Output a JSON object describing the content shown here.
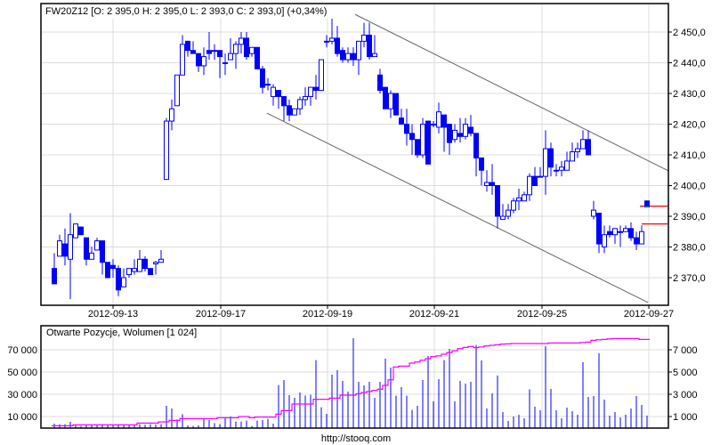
{
  "chart_data": [
    {
      "type": "candlestick",
      "title": "FW20Z12 [O: 2 395,0  H: 2 395,0  L: 2 393,0  C: 2 393,0] (+0,34%)",
      "x_tick_labels": [
        "2012-09-13",
        "2012-09-17",
        "2012-09-19",
        "2012-09-21",
        "2012-09-25",
        "2012-09-27"
      ],
      "y_tick_labels": [
        "2 450,0",
        "2 440,0",
        "2 430,0",
        "2 420,0",
        "2 410,0",
        "2 400,0",
        "2 390,0",
        "2 380,0",
        "2 370,0"
      ],
      "y_ticks": [
        2450,
        2440,
        2430,
        2420,
        2410,
        2400,
        2390,
        2380,
        2370
      ],
      "ylim": [
        2362,
        2465
      ],
      "grid": true,
      "colors": {
        "candle": "#0000ff",
        "channel": "#666666",
        "level": "#ff0000",
        "last_close_mark": "#00cc00"
      },
      "ohlc_columns": [
        "open",
        "high",
        "low",
        "close"
      ],
      "ohlc": [
        [
          2373,
          2378,
          2368,
          2368
        ],
        [
          2377,
          2384,
          2377,
          2382
        ],
        [
          2381,
          2386,
          2374,
          2377
        ],
        [
          2376,
          2391,
          2363,
          2384
        ],
        [
          2383,
          2387.5,
          2383,
          2387.5
        ],
        [
          2386.5,
          2386.5,
          2384,
          2384
        ],
        [
          2383,
          2383,
          2374,
          2376
        ],
        [
          2376,
          2380,
          2376,
          2378
        ],
        [
          2379,
          2383,
          2379,
          2382
        ],
        [
          2382,
          2382,
          2371,
          2375
        ],
        [
          2375,
          2375,
          2370,
          2370
        ],
        [
          2374,
          2376,
          2370,
          2373
        ],
        [
          2373,
          2374,
          2364,
          2366
        ],
        [
          2367,
          2373,
          2367,
          2370
        ],
        [
          2371,
          2373,
          2370,
          2373
        ],
        [
          2372,
          2376,
          2371,
          2373
        ],
        [
          2372,
          2379,
          2372,
          2376
        ],
        [
          2376,
          2377,
          2372,
          2373
        ],
        [
          2373,
          2373,
          2371,
          2371
        ],
        [
          2374.5,
          2375.5,
          2371,
          2375
        ],
        [
          2375,
          2379,
          2375,
          2376
        ],
        [
          2402,
          2422,
          2402,
          2421
        ],
        [
          2421,
          2428,
          2418,
          2425
        ],
        [
          2426,
          2436,
          2426,
          2436
        ],
        [
          2436,
          2449,
          2436,
          2446
        ],
        [
          2447,
          2447,
          2442,
          2444
        ],
        [
          2444,
          2447,
          2443,
          2443
        ],
        [
          2443,
          2443,
          2437,
          2439
        ],
        [
          2439,
          2445,
          2436,
          2442
        ],
        [
          2444,
          2450,
          2441,
          2443
        ],
        [
          2444,
          2446,
          2441,
          2444
        ],
        [
          2444,
          2444,
          2435,
          2442
        ],
        [
          2440,
          2443,
          2436,
          2440
        ],
        [
          2441,
          2448,
          2441,
          2443
        ],
        [
          2443,
          2447,
          2438,
          2446
        ],
        [
          2446,
          2450,
          2443,
          2448
        ],
        [
          2448,
          2450,
          2441,
          2442
        ],
        [
          2443,
          2445,
          2442,
          2445
        ],
        [
          2445,
          2445,
          2438,
          2438
        ],
        [
          2438,
          2439,
          2430,
          2432
        ],
        [
          2433,
          2435,
          2431,
          2433
        ],
        [
          2429,
          2433,
          2426,
          2432
        ],
        [
          2431,
          2431,
          2425,
          2429
        ],
        [
          2429,
          2429,
          2421,
          2426
        ],
        [
          2426,
          2428,
          2421,
          2423
        ],
        [
          2423,
          2425,
          2423,
          2425
        ],
        [
          2425,
          2429,
          2423,
          2428
        ],
        [
          2428,
          2432,
          2426,
          2429
        ],
        [
          2429,
          2432,
          2426,
          2432
        ],
        [
          2432,
          2436,
          2428,
          2431
        ],
        [
          2431,
          2441,
          2431,
          2441
        ],
        [
          2447,
          2449,
          2445,
          2447
        ],
        [
          2447,
          2455,
          2446,
          2448
        ],
        [
          2448,
          2452,
          2442,
          2443
        ],
        [
          2444,
          2445,
          2440,
          2441
        ],
        [
          2441,
          2445,
          2440,
          2443
        ],
        [
          2443,
          2445,
          2439,
          2441
        ],
        [
          2441,
          2447,
          2436,
          2447
        ],
        [
          2447,
          2453,
          2445,
          2449
        ],
        [
          2449,
          2453,
          2441,
          2442
        ],
        [
          2442,
          2449,
          2442,
          2443
        ],
        [
          2436,
          2438,
          2430,
          2431
        ],
        [
          2432,
          2432,
          2425,
          2425
        ],
        [
          2425,
          2431,
          2422,
          2430
        ],
        [
          2430,
          2430,
          2423,
          2423
        ],
        [
          2422,
          2425,
          2420,
          2420
        ],
        [
          2420,
          2425,
          2413,
          2417
        ],
        [
          2417,
          2420,
          2410,
          2415
        ],
        [
          2415,
          2415,
          2409,
          2410
        ],
        [
          2410,
          2422,
          2409,
          2420
        ],
        [
          2421,
          2421,
          2407,
          2407
        ],
        [
          2420,
          2421,
          2419,
          2420
        ],
        [
          2419,
          2427,
          2417,
          2424
        ],
        [
          2423,
          2423,
          2411,
          2419
        ],
        [
          2420,
          2420,
          2410,
          2414
        ],
        [
          2415,
          2420,
          2414,
          2418
        ],
        [
          2417,
          2422,
          2414,
          2416
        ],
        [
          2416,
          2422,
          2415,
          2420
        ],
        [
          2419,
          2423,
          2416,
          2417
        ],
        [
          2417,
          2417,
          2403,
          2409
        ],
        [
          2409,
          2409,
          2400,
          2405
        ],
        [
          2400,
          2405,
          2398,
          2401
        ],
        [
          2401,
          2407,
          2397,
          2400
        ],
        [
          2400,
          2400,
          2386,
          2390
        ],
        [
          2389,
          2394,
          2389,
          2390
        ],
        [
          2390,
          2394,
          2389,
          2392
        ],
        [
          2392,
          2396,
          2391,
          2395
        ],
        [
          2395,
          2399,
          2392,
          2396
        ],
        [
          2395,
          2398,
          2395,
          2397
        ],
        [
          2397,
          2404,
          2395,
          2403
        ],
        [
          2403,
          2406,
          2400,
          2400
        ],
        [
          2403,
          2406,
          2403,
          2403
        ],
        [
          2403,
          2418,
          2397,
          2412
        ],
        [
          2412,
          2414,
          2403,
          2406
        ],
        [
          2405,
          2407,
          2403,
          2405
        ],
        [
          2405,
          2408,
          2403,
          2406
        ],
        [
          2405,
          2411,
          2405,
          2408
        ],
        [
          2408,
          2414,
          2408,
          2411
        ],
        [
          2411,
          2414,
          2409,
          2412
        ],
        [
          2412,
          2418,
          2412,
          2415
        ],
        [
          2415,
          2418,
          2410,
          2410
        ],
        [
          2390,
          2395,
          2389,
          2392
        ],
        [
          2391,
          2391,
          2378,
          2381
        ],
        [
          2380,
          2387,
          2378,
          2384
        ],
        [
          2385,
          2387,
          2383,
          2384
        ],
        [
          2384,
          2386,
          2381,
          2386
        ],
        [
          2385,
          2387,
          2380,
          2385
        ],
        [
          2385,
          2387,
          2385,
          2386
        ],
        [
          2386,
          2388,
          2382,
          2383
        ],
        [
          2383,
          2385,
          2379,
          2381
        ],
        [
          2381,
          2387,
          2381,
          2385
        ],
        [
          2395,
          2395,
          2393,
          2393
        ]
      ],
      "channel_lines": [
        {
          "name": "upper",
          "from": {
            "index": 54.3,
            "price": 2457.5
          },
          "to": {
            "index": 115,
            "price": 2404.8
          }
        },
        {
          "name": "lower",
          "from": {
            "index": 39.8,
            "price": 2423.6
          },
          "to": {
            "index": 111.2,
            "price": 2361.9
          }
        }
      ],
      "levels": [
        2393.3,
        2387.5
      ]
    },
    {
      "type": "bar+line",
      "title": "Otwarte Pozycje, Wolumen [1 024]",
      "left_axis": {
        "label": "Otwarte Pozycje",
        "ticks": [
          70000,
          50000,
          30000,
          10000
        ],
        "tick_labels": [
          "70 000",
          "50 000",
          "30 000",
          "10 000"
        ],
        "ylim": [
          0,
          92000
        ]
      },
      "right_axis": {
        "label": "Wolumen",
        "ticks": [
          7000,
          5000,
          3000,
          1000
        ],
        "tick_labels": [
          "7 000",
          "5 000",
          "3 000",
          "1 000"
        ],
        "ylim": [
          0,
          9200
        ]
      },
      "colors": {
        "volume": "#0000ff",
        "open_interest": "#ff00ff"
      },
      "volume": [
        360,
        310,
        310,
        520,
        270,
        150,
        270,
        270,
        270,
        310,
        270,
        270,
        310,
        270,
        270,
        270,
        310,
        270,
        310,
        270,
        310,
        1960,
        1720,
        733,
        1213,
        200,
        150,
        200,
        787,
        680,
        413,
        307,
        893,
        1000,
        547,
        547,
        627,
        150,
        627,
        680,
        787,
        360,
        3827,
        4280,
        2920,
        2680,
        3160,
        2893,
        2947,
        6067,
        1827,
        1240,
        4760,
        5160,
        4200,
        3240,
        8040,
        4120,
        3800,
        4120,
        2680,
        4120,
        6200,
        5400,
        2867,
        3640,
        2867,
        1587,
        1960,
        4280,
        6440,
        2360,
        4360,
        6067,
        7080,
        2360,
        4200,
        3960,
        4120,
        7427,
        6040,
        1720,
        3080,
        4680,
        1400,
        600,
        1000,
        1160,
        840,
        3440,
        1880,
        1560,
        7320,
        3480,
        1560,
        840,
        1800,
        1480,
        1160,
        5880,
        2760,
        2840,
        6680,
        2520,
        1080,
        1400,
        920,
        1160,
        1720,
        2840,
        2040,
        1080
      ],
      "open_interest": [
        1700,
        1700,
        1700,
        1700,
        2500,
        2500,
        2500,
        2500,
        2500,
        2500,
        2500,
        2500,
        2500,
        2500,
        2500,
        2500,
        4100,
        4100,
        4100,
        4100,
        5200,
        5200,
        6500,
        6500,
        8100,
        8100,
        8100,
        8100,
        8100,
        8100,
        8100,
        8900,
        8900,
        8900,
        8900,
        10000,
        10000,
        8900,
        9500,
        9500,
        9500,
        9500,
        12100,
        15300,
        15300,
        21200,
        21200,
        21200,
        21200,
        25500,
        25500,
        25500,
        26500,
        26500,
        29200,
        29200,
        29200,
        30500,
        31500,
        32500,
        33500,
        34500,
        38000,
        43000,
        54500,
        55300,
        55300,
        58000,
        59000,
        60600,
        62000,
        63900,
        64500,
        66000,
        67500,
        69000,
        71000,
        72100,
        73000,
        71900,
        72500,
        73500,
        74000,
        74500,
        75100,
        75300,
        75600,
        75600,
        75600,
        75600,
        75600,
        75600,
        75600,
        76100,
        76100,
        76100,
        76100,
        76100,
        76100,
        76500,
        76900,
        78500,
        79000,
        79300,
        79800,
        80100,
        80100,
        80100,
        80100,
        80100,
        79300,
        79300
      ]
    }
  ],
  "footer": "http://stooq.com"
}
